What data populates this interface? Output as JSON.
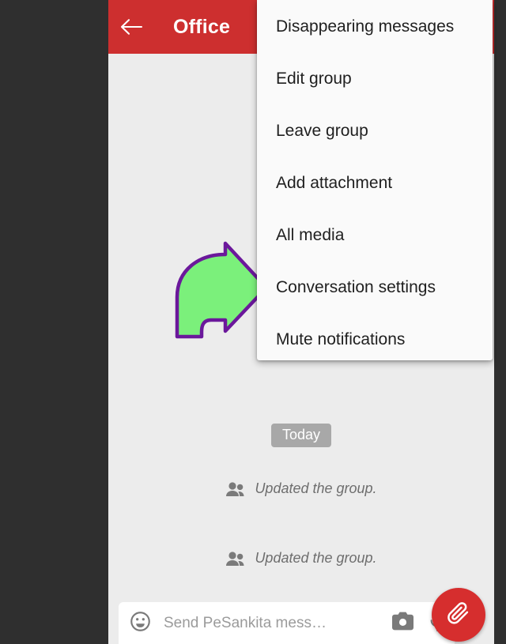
{
  "app_bar": {
    "back_icon": "arrow-left-icon",
    "title": "Office",
    "background_color": "#cd2f2f",
    "title_color": "#ffffff"
  },
  "overflow_menu": {
    "background_color": "#fafafa",
    "items": [
      {
        "label": "Disappearing messages"
      },
      {
        "label": "Edit group"
      },
      {
        "label": "Leave group"
      },
      {
        "label": "Add attachment"
      },
      {
        "label": "All media"
      },
      {
        "label": "Conversation settings"
      },
      {
        "label": "Mute notifications"
      }
    ]
  },
  "annotation": {
    "type": "curved-right-arrow",
    "fill_color": "#7bf07b",
    "stroke_color": "#6b189b",
    "points_to": "Conversation settings"
  },
  "chat": {
    "background_color": "#ececec",
    "date_badge": {
      "label": "Today",
      "background_color": "#a8a8a8",
      "text_color": "#ffffff"
    },
    "events": [
      {
        "icon": "group-people-icon",
        "text": "Updated the group."
      },
      {
        "icon": "group-people-icon",
        "text": "Updated the group."
      }
    ]
  },
  "compose": {
    "emoji_icon": "smiley-face-icon",
    "placeholder": "Send PeSankita mess…",
    "value": "",
    "camera_icon": "camera-icon",
    "mic_icon": "microphone-icon",
    "attach_button": {
      "icon": "paperclip-icon",
      "background_color": "#d62e2e"
    }
  }
}
